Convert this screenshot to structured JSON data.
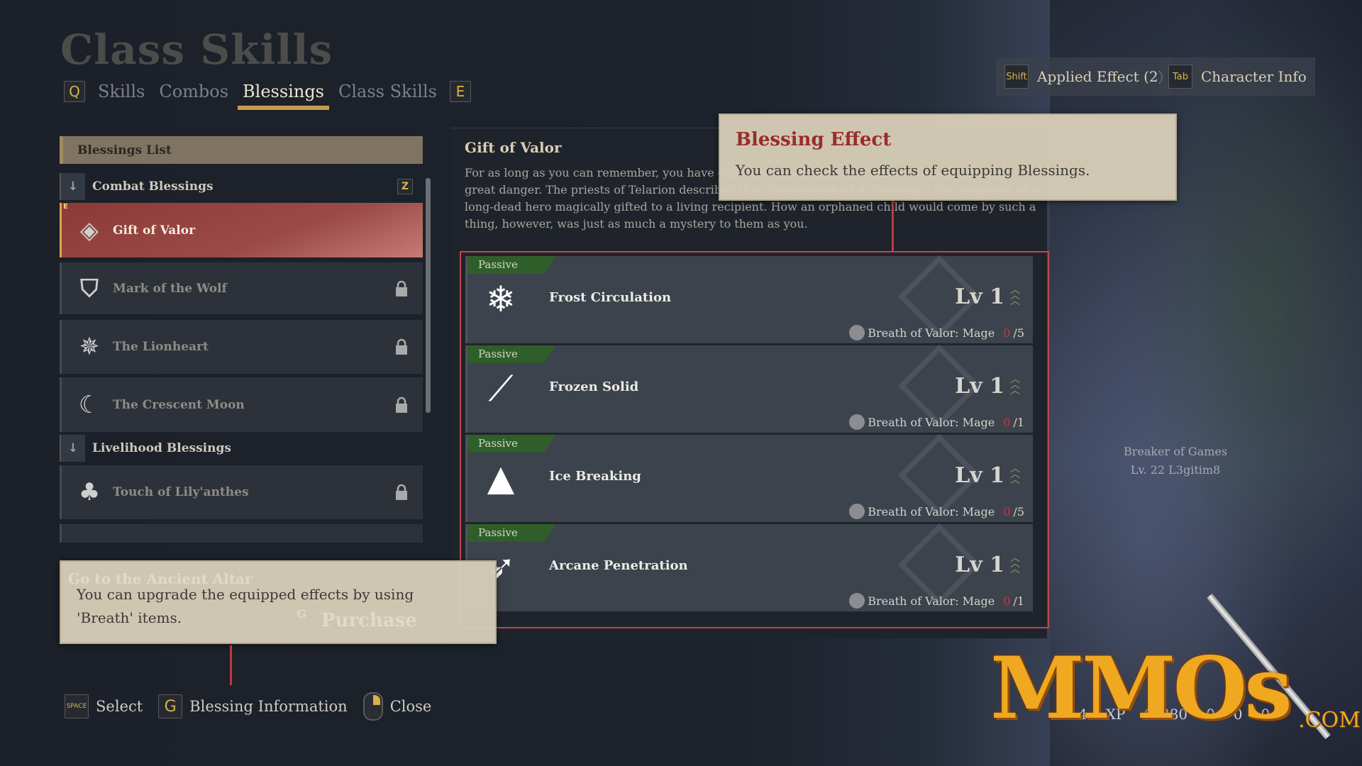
{
  "header": {
    "title": "Class Skills",
    "prev_key": "Q",
    "next_key": "E",
    "tabs": [
      {
        "label": "Skills",
        "active": false
      },
      {
        "label": "Combos",
        "active": false
      },
      {
        "label": "Blessings",
        "active": true
      },
      {
        "label": "Class Skills",
        "active": false
      }
    ]
  },
  "top_buttons": [
    {
      "key": "Shift",
      "label": "Applied Effect (2)"
    },
    {
      "key": "Tab",
      "label": "Character Info"
    }
  ],
  "list": {
    "header": "Blessings List",
    "categories": [
      {
        "label": "Combat Blessings",
        "key": "Z"
      },
      {
        "label": "Livelihood Blessings"
      }
    ],
    "items": [
      {
        "label": "Gift of Valor",
        "selected": true,
        "equipped_badge": "E",
        "icon": "diamond-rune-icon"
      },
      {
        "label": "Mark of the Wolf",
        "locked": true,
        "icon": "wolf-icon"
      },
      {
        "label": "The Lionheart",
        "locked": true,
        "icon": "sun-compass-icon"
      },
      {
        "label": "The Crescent Moon",
        "locked": true,
        "icon": "crescent-moon-icon"
      },
      {
        "label": "Touch of Lily'anthes",
        "locked": true,
        "icon": "tree-icon"
      }
    ]
  },
  "detail": {
    "title": "Gift of Valor",
    "description": "For as long as you can remember, you have experienced a heightened instinct during times of great danger. The priests of Telarion described this phenomenon as a \"blessing\": the memories of a long-dead hero magically gifted to a living recipient. How an orphaned child would come by such a thing, however, was just as much a mystery to them as you.",
    "effects": [
      {
        "type": "Passive",
        "name": "Frost Circulation",
        "level": "Lv 1",
        "material": "Breath of Valor: Mage",
        "have": "0",
        "need": "/5",
        "icon": "snowflake-icon"
      },
      {
        "type": "Passive",
        "name": "Frozen Solid",
        "level": "Lv 1",
        "material": "Breath of Valor: Mage",
        "have": "0",
        "need": "/1",
        "icon": "ice-shards-icon"
      },
      {
        "type": "Passive",
        "name": "Ice Breaking",
        "level": "Lv 1",
        "material": "Breath of Valor: Mage",
        "have": "0",
        "need": "/5",
        "icon": "ice-crystal-icon"
      },
      {
        "type": "Passive",
        "name": "Arcane Penetration",
        "level": "Lv 1",
        "material": "Breath of Valor: Mage",
        "have": "0",
        "need": "/1",
        "icon": "arcane-arrow-icon"
      }
    ]
  },
  "tooltips": {
    "effect_title": "Blessing Effect",
    "effect_body": "You can check the effects of equipping Blessings.",
    "upgrade_body_1": "You can upgrade the equipped effects by using",
    "upgrade_body_2": "'Breath' items.",
    "behind_quest": "Go to the Ancient Altar",
    "behind_button_key": "G",
    "behind_button": "Purchase"
  },
  "footer": [
    {
      "key": "SPACE",
      "label": "Select"
    },
    {
      "key": "G",
      "label": "Blessing Information"
    },
    {
      "key": "mouse-right",
      "label": "Close"
    }
  ],
  "character": {
    "title": "Breaker of Games",
    "level_name": "Lv. 22 L3gitim8"
  },
  "hud": {
    "level": "4",
    "xp_label": "XP",
    "currency": "6?380",
    "c2": "0",
    "c3": "0",
    "c4": "0"
  },
  "watermark": {
    "text": "MMOs",
    ".com": ".COM"
  },
  "colors": {
    "accent_gold": "#c99a4e",
    "selected_red": "#8c3a37",
    "passive_green": "#2f5e2a",
    "tooltip_title_red": "#9b2c2c",
    "highlight_red": "#c0474b"
  }
}
